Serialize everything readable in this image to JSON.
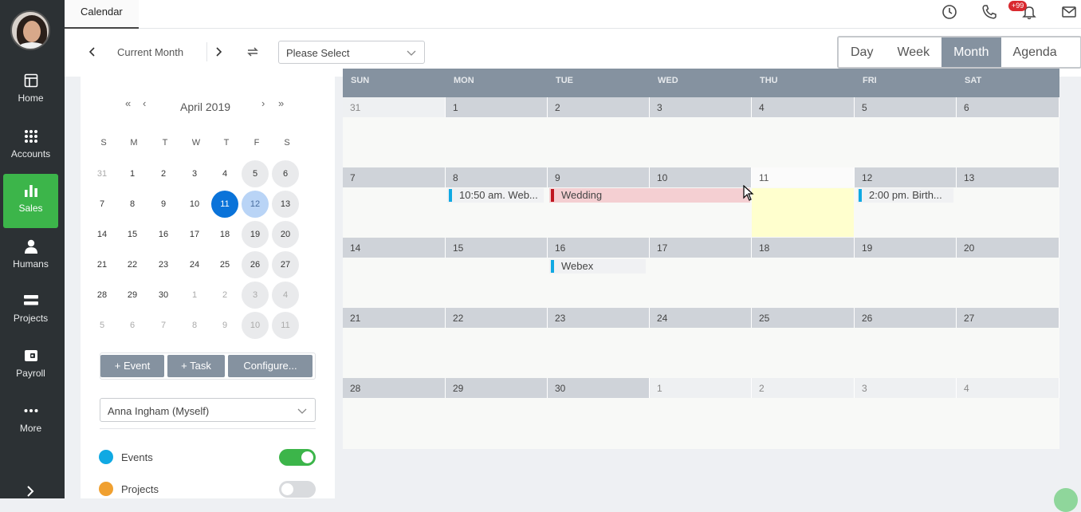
{
  "sidebar": {
    "items": [
      {
        "label": "Home",
        "icon": "home-icon"
      },
      {
        "label": "Accounts",
        "icon": "grid-dots-icon"
      },
      {
        "label": "Sales",
        "icon": "bar-chart-icon",
        "active": true
      },
      {
        "label": "Humans",
        "icon": "person-icon"
      },
      {
        "label": "Projects",
        "icon": "bars-icon"
      },
      {
        "label": "Payroll",
        "icon": "wallet-icon"
      },
      {
        "label": "More",
        "icon": "more-dots-icon"
      }
    ]
  },
  "topbar": {
    "tab_label": "Calendar",
    "notif_count": "+99"
  },
  "toolbar": {
    "current_label": "Current Month",
    "select_placeholder": "Please Select"
  },
  "views": {
    "day": "Day",
    "week": "Week",
    "month": "Month",
    "agenda": "Agenda"
  },
  "mini": {
    "month_label": "April 2019",
    "prev_year": "«",
    "prev_month": "‹",
    "next_month": "›",
    "next_year": "»",
    "dow": [
      "S",
      "M",
      "T",
      "W",
      "T",
      "F",
      "S"
    ],
    "weeks": [
      [
        "31",
        "1",
        "2",
        "3",
        "4",
        "5",
        "6"
      ],
      [
        "7",
        "8",
        "9",
        "10",
        "11",
        "12",
        "13"
      ],
      [
        "14",
        "15",
        "16",
        "17",
        "18",
        "19",
        "20"
      ],
      [
        "21",
        "22",
        "23",
        "24",
        "25",
        "26",
        "27"
      ],
      [
        "28",
        "29",
        "30",
        "1",
        "2",
        "3",
        "4"
      ],
      [
        "5",
        "6",
        "7",
        "8",
        "9",
        "10",
        "11"
      ]
    ]
  },
  "buttons": {
    "event": "+ Event",
    "task": "+ Task",
    "configure": "Configure..."
  },
  "user_select": "Anna Ingham (Myself)",
  "legend": [
    {
      "label": "Events",
      "color": "#10a9e3",
      "on": true
    },
    {
      "label": "Projects",
      "color": "#f0a030",
      "on": false
    }
  ],
  "month": {
    "headers": [
      "SUN",
      "MON",
      "TUE",
      "WED",
      "THU",
      "FRI",
      "SAT"
    ],
    "weeks": [
      [
        "31",
        "1",
        "2",
        "3",
        "4",
        "5",
        "6"
      ],
      [
        "7",
        "8",
        "9",
        "10",
        "11",
        "12",
        "13"
      ],
      [
        "14",
        "15",
        "16",
        "17",
        "18",
        "19",
        "20"
      ],
      [
        "21",
        "22",
        "23",
        "24",
        "25",
        "26",
        "27"
      ],
      [
        "28",
        "29",
        "30",
        "1",
        "2",
        "3",
        "4"
      ]
    ],
    "events": {
      "webinar": "10:50 am. Web...",
      "wedding": "Wedding",
      "birthday": "2:00 pm. Birth...",
      "webex": "Webex"
    },
    "colors": {
      "blue": "#10a9e3",
      "red": "#c0151f",
      "wedding_bg": "#f4cfd2"
    }
  }
}
